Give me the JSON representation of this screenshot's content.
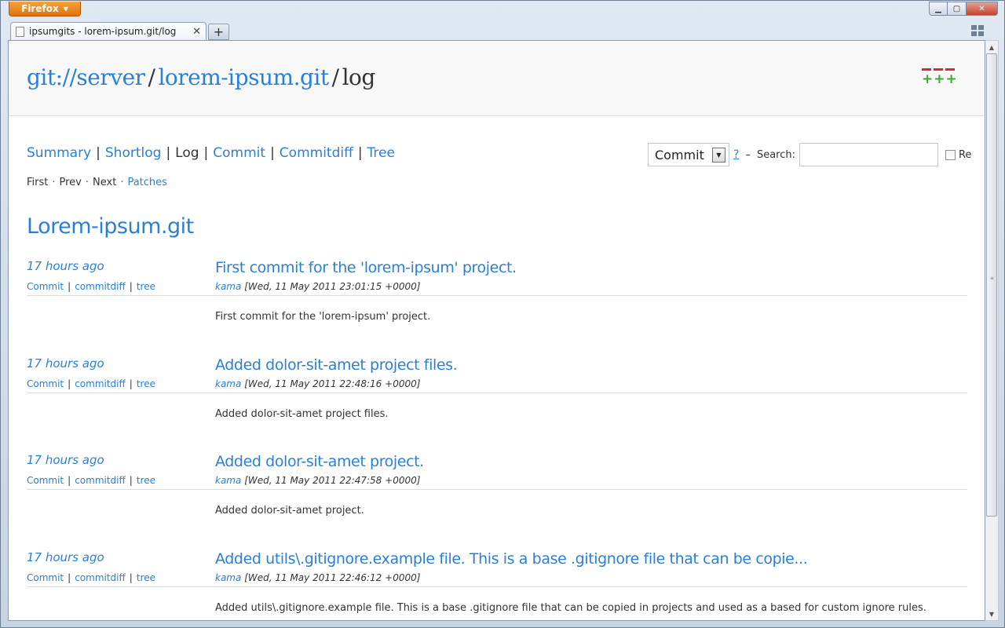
{
  "browser": {
    "app_button": "Firefox",
    "tab_title": "ipsumgits - lorem-ipsum.git/log",
    "new_tab_label": "+"
  },
  "header": {
    "crumbs": [
      "git://server",
      "lorem-ipsum.git",
      "log"
    ],
    "separator": "/"
  },
  "nav": {
    "items": [
      {
        "label": "Summary",
        "current": false
      },
      {
        "label": "Shortlog",
        "current": false
      },
      {
        "label": "Log",
        "current": true
      },
      {
        "label": "Commit",
        "current": false
      },
      {
        "label": "Commitdiff",
        "current": false
      },
      {
        "label": "Tree",
        "current": false
      }
    ],
    "separator": "|"
  },
  "search": {
    "type_selected": "Commit",
    "help": "?",
    "dash": "–",
    "label": "Search:",
    "value": "",
    "regex_label": "Re"
  },
  "pager": {
    "first": "First",
    "prev": "Prev",
    "next": "Next",
    "patches": "Patches"
  },
  "project_title": "Lorem-ipsum.git",
  "commits": [
    {
      "age": "17 hours ago",
      "subject": "First commit for the 'lorem-ipsum' project.",
      "author": "kama",
      "date": "[Wed, 11 May 2011 23:01:15 +0000]",
      "body": "First commit for the 'lorem-ipsum' project."
    },
    {
      "age": "17 hours ago",
      "subject": "Added dolor-sit-amet project files.",
      "author": "kama",
      "date": "[Wed, 11 May 2011 22:48:16 +0000]",
      "body": "Added dolor-sit-amet project files."
    },
    {
      "age": "17 hours ago",
      "subject": "Added dolor-sit-amet project.",
      "author": "kama",
      "date": "[Wed, 11 May 2011 22:47:58 +0000]",
      "body": "Added dolor-sit-amet project."
    },
    {
      "age": "17 hours ago",
      "subject": "Added utils\\.gitignore.example file. This is a base .gitignore file that can be copie...",
      "author": "kama",
      "date": "[Wed, 11 May 2011 22:46:12 +0000]",
      "body": "Added utils\\.gitignore.example file. This is a base .gitignore file that can be copied in projects and used as a based for custom ignore rules."
    }
  ],
  "commit_links": {
    "commit": "Commit",
    "commitdiff": "commitdiff",
    "tree": "tree",
    "separator": "|"
  },
  "colors": {
    "link": "#2a7fd8",
    "logo_minus": "#e0243e",
    "logo_plus": "#39a935",
    "firefox_button": "#e0720c"
  }
}
